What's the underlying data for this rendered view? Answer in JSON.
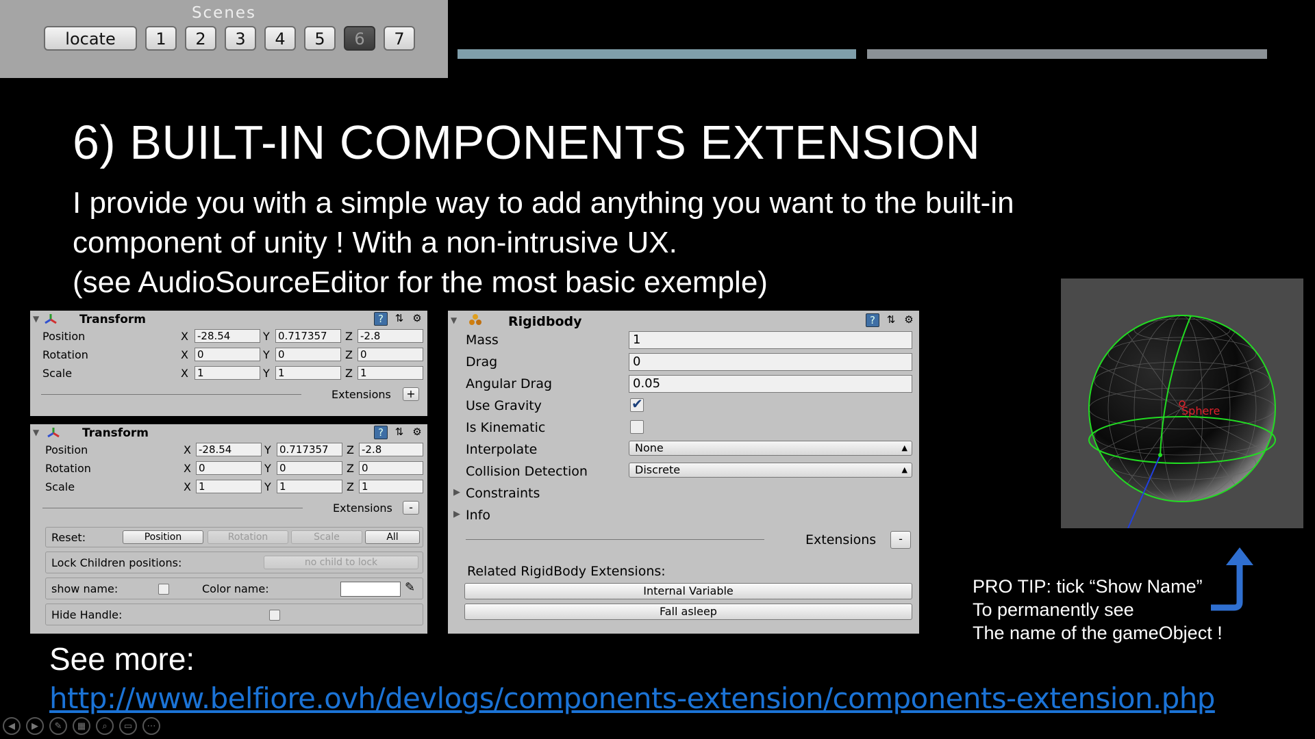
{
  "scenes": {
    "title": "Scenes",
    "locate_label": "locate",
    "buttons": [
      "1",
      "2",
      "3",
      "4",
      "5",
      "6",
      "7"
    ],
    "active": "6"
  },
  "slide": {
    "title": "6) BUILT-IN COMPONENTS EXTENSION",
    "body_lines": [
      "I provide you with a simple way to add anything you want to the built-in",
      "component of unity ! With a non-intrusive UX.",
      "(see AudioSourceEditor for the most basic exemple)"
    ]
  },
  "transform_collapsed": {
    "title": "Transform",
    "rows": [
      {
        "label": "Position",
        "x": "-28.54",
        "y": "0.717357",
        "z": "-2.8"
      },
      {
        "label": "Rotation",
        "x": "0",
        "y": "0",
        "z": "0"
      },
      {
        "label": "Scale",
        "x": "1",
        "y": "1",
        "z": "1"
      }
    ],
    "extensions_label": "Extensions",
    "toggle": "+"
  },
  "transform_expanded": {
    "title": "Transform",
    "rows": [
      {
        "label": "Position",
        "x": "-28.54",
        "y": "0.717357",
        "z": "-2.8"
      },
      {
        "label": "Rotation",
        "x": "0",
        "y": "0",
        "z": "0"
      },
      {
        "label": "Scale",
        "x": "1",
        "y": "1",
        "z": "1"
      }
    ],
    "extensions_label": "Extensions",
    "toggle": "-",
    "reset_label": "Reset:",
    "reset_buttons": {
      "position": "Position",
      "rotation": "Rotation",
      "scale": "Scale",
      "all": "All"
    },
    "lock_label": "Lock Children positions:",
    "lock_button": "no child to lock",
    "show_name_label": "show name:",
    "color_name_label": "Color name:",
    "hide_handle_label": "Hide Handle:"
  },
  "axes": {
    "x": "X",
    "y": "Y",
    "z": "Z"
  },
  "rigidbody": {
    "title": "Rigidbody",
    "mass_label": "Mass",
    "mass": "1",
    "drag_label": "Drag",
    "drag": "0",
    "angular_drag_label": "Angular Drag",
    "angular_drag": "0.05",
    "use_gravity_label": "Use Gravity",
    "use_gravity": true,
    "is_kinematic_label": "Is Kinematic",
    "is_kinematic": false,
    "interpolate_label": "Interpolate",
    "interpolate": "None",
    "collision_label": "Collision Detection",
    "collision": "Discrete",
    "constraints_label": "Constraints",
    "info_label": "Info",
    "extensions_label": "Extensions",
    "toggle": "-",
    "related_label": "Related RigidBody Extensions:",
    "internal_variable": "Internal Variable",
    "fall_asleep": "Fall asleep"
  },
  "viewport": {
    "object_name": "Sphere",
    "name_color": "#e0202a",
    "wire_color": "#22dd22"
  },
  "protip": {
    "lines": [
      "PRO TIP: tick “Show Name”",
      "To permanently see",
      "The name of the gameObject !"
    ],
    "arrow_color": "#2f6fd0"
  },
  "see_more": {
    "label": "See more:",
    "url": "http://www.belfiore.ovh/devlogs/components-extension/components-extension.php"
  },
  "navbar_icons": [
    "prev-icon",
    "next-icon",
    "pen-icon",
    "slides-icon",
    "zoom-icon",
    "subtitle-icon",
    "more-icon"
  ]
}
